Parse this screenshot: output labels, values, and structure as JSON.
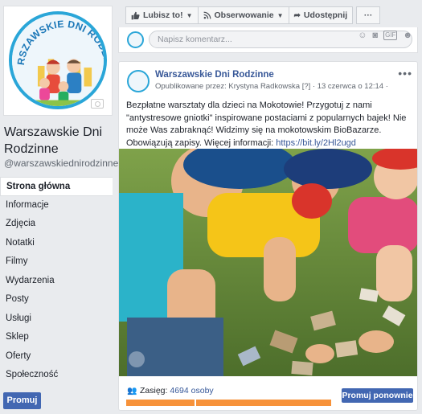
{
  "page": {
    "name": "Warszawskie Dni Rodzinne",
    "handle": "@warszawskiednirodzinne",
    "logo_text": "WARSZAWSKIE DNI RODZINNE"
  },
  "nav": {
    "items": [
      {
        "label": "Strona główna",
        "active": true
      },
      {
        "label": "Informacje"
      },
      {
        "label": "Zdjęcia"
      },
      {
        "label": "Notatki"
      },
      {
        "label": "Filmy"
      },
      {
        "label": "Wydarzenia"
      },
      {
        "label": "Posty"
      },
      {
        "label": "Usługi"
      },
      {
        "label": "Sklep"
      },
      {
        "label": "Oferty"
      },
      {
        "label": "Społeczność"
      }
    ],
    "promote_label": "Promuj"
  },
  "actionbar": {
    "like_label": "Lubisz to!",
    "follow_label": "Obserwowanie",
    "share_label": "Udostępnij",
    "more_label": "···"
  },
  "comment": {
    "placeholder": "Napisz komentarz..."
  },
  "post": {
    "author": "Warszawskie Dni Rodzinne",
    "published_by": "Opublikowane przez: Krystyna Radkowska [?] · 13 czerwca o 12:14 ·",
    "text": "Bezpłatne warsztaty dla dzieci na Mokotowie! Przygotuj z nami \"antystresowe gniotki\" inspirowane postaciami z popularnych bajek! Nie może Was zabraknąć! Widzimy się na mokotowskim BioBazarze. Obowiązują zapisy. Więcej informacji: ",
    "link": "https://bit.ly/2Hl2ugd",
    "reach_label": "Zasięg:",
    "reach_value": "4694 osoby",
    "boost_label": "Promuj ponownie"
  },
  "colors": {
    "brand_blue": "#4267b2",
    "link_blue": "#385898",
    "reach_orange": "#f7923a"
  },
  "icons": {
    "like": "thumbs-up-icon",
    "follow": "rss-icon",
    "share": "share-arrow-icon",
    "reach": "people-icon"
  }
}
